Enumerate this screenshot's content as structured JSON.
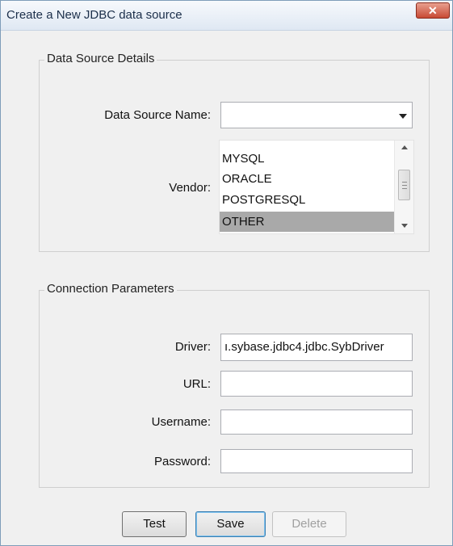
{
  "window": {
    "title": "Create a New JDBC data source",
    "close_glyph": "✕"
  },
  "details": {
    "legend": "Data Source Details",
    "name_label": "Data Source Name:",
    "name_value": "",
    "vendor_label": "Vendor:",
    "vendor_options": [
      "MYSQL",
      "ORACLE",
      "POSTGRESQL",
      "OTHER"
    ],
    "vendor_selected": "OTHER"
  },
  "connection": {
    "legend": "Connection Parameters",
    "driver_label": "Driver:",
    "driver_value": "ı.sybase.jdbc4.jdbc.SybDriver",
    "url_label": "URL:",
    "url_value": "",
    "username_label": "Username:",
    "username_value": "",
    "password_label": "Password:",
    "password_value": ""
  },
  "buttons": {
    "test": "Test",
    "save": "Save",
    "delete": "Delete"
  },
  "colors": {
    "selection": "#a9a9a9",
    "close_button": "#c74a34",
    "window_bg": "#f0f0f0"
  }
}
